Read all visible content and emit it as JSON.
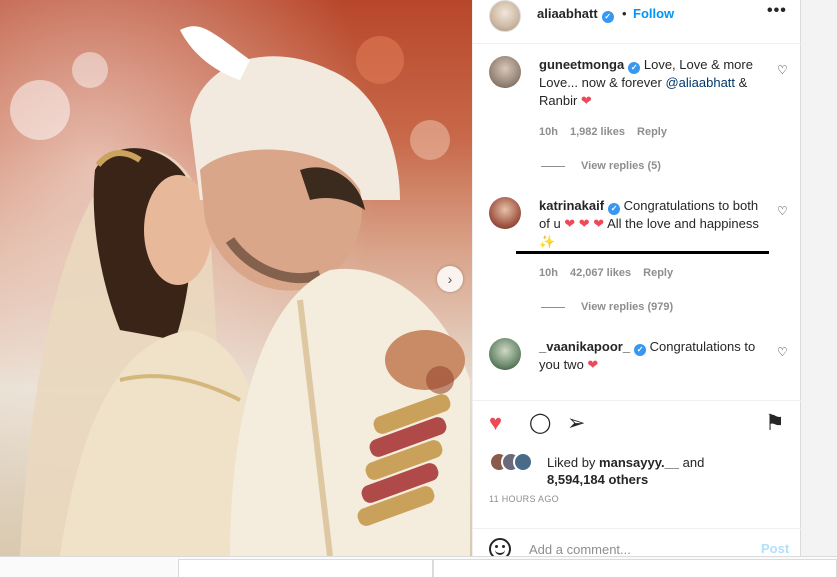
{
  "post": {
    "next_arrow": "›"
  },
  "header": {
    "username": "aliaabhatt",
    "verified_mark": "✓",
    "separator": "•",
    "follow_label": "Follow",
    "more_label": "•••"
  },
  "comments": [
    {
      "username": "guneetmonga",
      "verified": true,
      "text_before": "Love, Love & more Love... now & forever ",
      "mention": "@aliaabhatt",
      "text_after": " & Ranbir ",
      "emoji": "❤",
      "time": "10h",
      "likes": "1,982 likes",
      "reply": "Reply",
      "view_replies": "View replies (5)"
    },
    {
      "username": "katrinakaif",
      "verified": true,
      "text_before": "Congratulations to both of u ",
      "hearts": "❤ ❤ ❤",
      "text_after": " All the love and happiness ",
      "emoji": "✨",
      "time": "10h",
      "likes": "42,067 likes",
      "reply": "Reply",
      "view_replies": "View replies (979)"
    },
    {
      "username": "_vaanikapoor_",
      "verified": true,
      "text_before": "Congratulations to you two ",
      "emoji": "❤"
    }
  ],
  "like_icon": "♡",
  "actions": {
    "like": "♥",
    "comment": "◯",
    "share": "➢",
    "save": "⚑"
  },
  "liked_by": {
    "prefix": "Liked by ",
    "user": "mansayyy.__",
    "middle": " and",
    "count": "8,594,184 others"
  },
  "timestamp": "11 HOURS AGO",
  "add_comment": {
    "placeholder": "Add a comment...",
    "post_label": "Post"
  },
  "colors": {
    "accent": "#0095f6",
    "heart": "#ed4956",
    "verified": "#3897f0",
    "post_disabled": "#b2dffc"
  }
}
